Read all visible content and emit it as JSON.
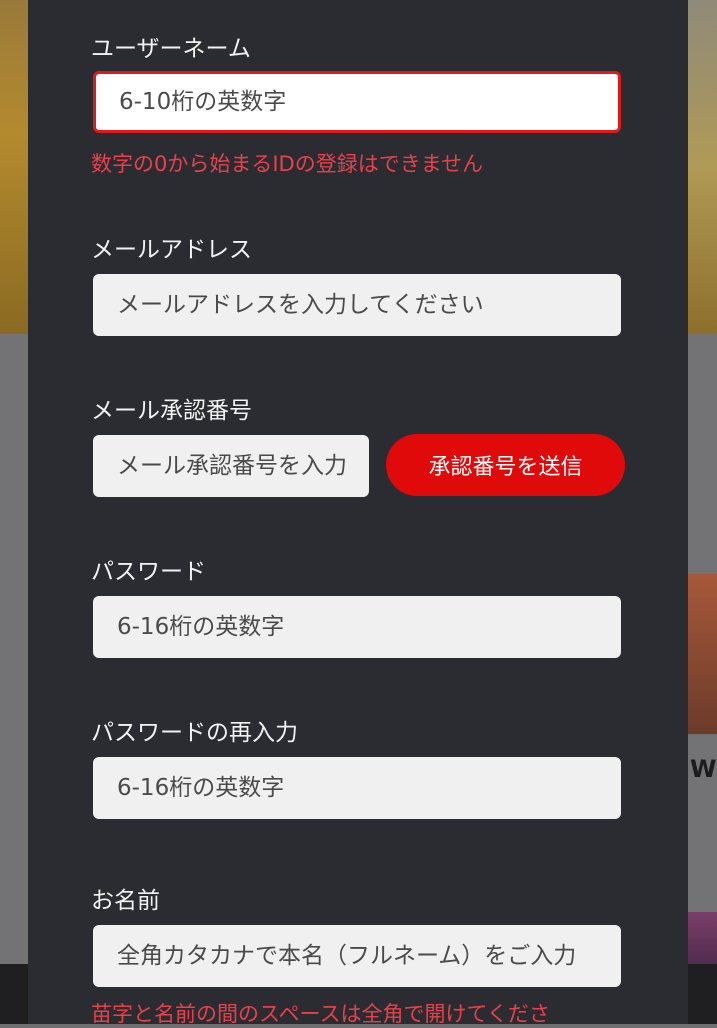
{
  "form": {
    "username": {
      "label": "ユーザーネーム",
      "placeholder": "6-10桁の英数字",
      "error": "数字の0から始まるIDの登録はできません"
    },
    "email": {
      "label": "メールアドレス",
      "placeholder": "メールアドレスを入力してください"
    },
    "verification": {
      "label": "メール承認番号",
      "placeholder": "メール承認番号を入力",
      "send_button": "承認番号を送信"
    },
    "password": {
      "label": "パスワード",
      "placeholder": "6-16桁の英数字"
    },
    "password_confirm": {
      "label": "パスワードの再入力",
      "placeholder": "6-16桁の英数字"
    },
    "name": {
      "label": "お名前",
      "placeholder": "全角カタカナで本名（フルネーム）をご入力",
      "hint": "苗字と名前の間のスペースは全角で開けてくださ"
    }
  },
  "background": {
    "partial_text": "W"
  },
  "colors": {
    "modal_bg": "#2b2c31",
    "accent_red": "#e00a0a",
    "error_text": "#e8414a",
    "input_bg": "#f0f0f0"
  }
}
